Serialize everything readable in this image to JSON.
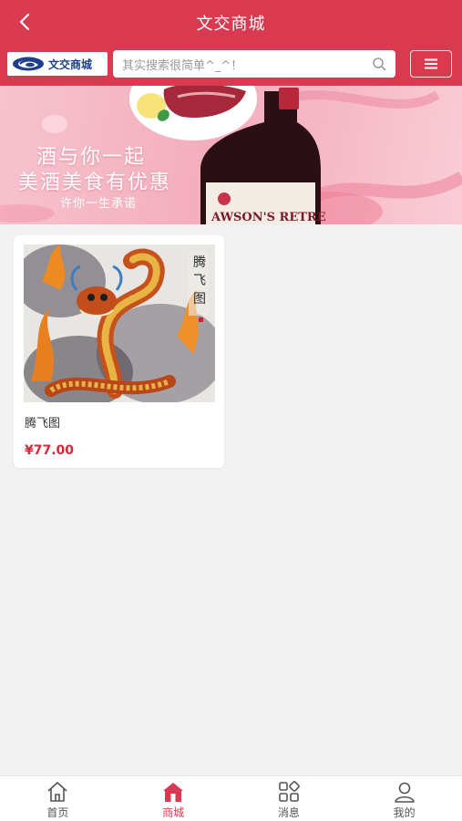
{
  "header": {
    "title": "文交商城",
    "back_icon": "chevron-left-icon"
  },
  "search": {
    "logo_text": "文交商城",
    "placeholder": "其实搜索很简单^_^！",
    "search_icon": "search-icon",
    "menu_icon": "menu-icon"
  },
  "banner": {
    "line1": "酒与你一起",
    "line2": "美酒美食有优惠",
    "line3": "许你一生承诺",
    "bottle_label": "AWSON'S RETRE"
  },
  "products": [
    {
      "name": "腾飞图",
      "price": "¥77.00",
      "artwork_text": "腾飞图"
    }
  ],
  "tabs": [
    {
      "label": "首页",
      "icon": "home-icon",
      "active": false
    },
    {
      "label": "商城",
      "icon": "shop-icon",
      "active": true
    },
    {
      "label": "消息",
      "icon": "grid-icon",
      "active": false
    },
    {
      "label": "我的",
      "icon": "user-icon",
      "active": false
    }
  ],
  "colors": {
    "brand": "#d93a4f",
    "price": "#d3283a",
    "background": "#f2f2f2"
  }
}
